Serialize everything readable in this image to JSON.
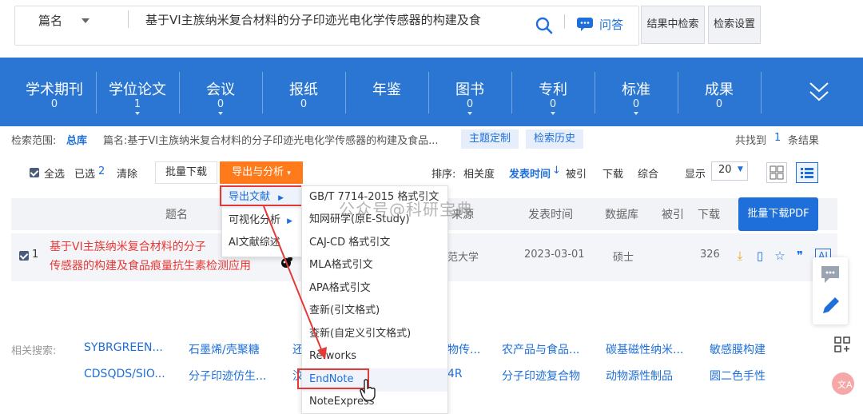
{
  "search": {
    "field": "篇名",
    "query": "基于VI主族纳米复合材料的分子印迹光电化学传感器的构建及食",
    "wenda": "问答",
    "in_results": "结果中检索",
    "settings": "检索设置"
  },
  "nav": [
    {
      "label": "学术期刊",
      "count": "0"
    },
    {
      "label": "学位论文",
      "count": "1"
    },
    {
      "label": "会议",
      "count": "0"
    },
    {
      "label": "报纸",
      "count": "0"
    },
    {
      "label": "年鉴",
      "count": ""
    },
    {
      "label": "图书",
      "count": "0"
    },
    {
      "label": "专利",
      "count": "0"
    },
    {
      "label": "标准",
      "count": "0"
    },
    {
      "label": "成果",
      "count": "0"
    }
  ],
  "scope": {
    "label": "检索范围:",
    "db": "总库",
    "condition": "篇名:基于VI主族纳米复合材料的分子印迹光电化学传感器的构建及食品...",
    "topic_btn": "主题定制",
    "history_btn": "检索历史",
    "found_prefix": "共找到",
    "found_count": "1",
    "found_suffix": "条结果"
  },
  "toolbar": {
    "select_all": "全选",
    "selected": "已选",
    "selected_count": "2",
    "clear": "清除",
    "batch_download": "批量下载",
    "export": "导出与分析",
    "sort_label": "排序:",
    "sort_relevance": "相关度",
    "sort_date": "发表时间",
    "sort_cited": "被引",
    "sort_download": "下载",
    "sort_overall": "综合",
    "display_label": "显示",
    "display_value": "20"
  },
  "table": {
    "headers": [
      "题名",
      "来源",
      "发表时间",
      "数据库",
      "被引",
      "下载"
    ],
    "pdf_button": "批量下载PDF",
    "row": {
      "index": "1",
      "title_line1": "基于VI主族纳米复合材料的分子",
      "title_line2": "传感器的构建及食品痕量抗生素检测应用",
      "source": "范大学",
      "date": "2023-03-01",
      "db": "硕士",
      "downloads": "326"
    }
  },
  "export_menu": [
    "导出文献",
    "可视化分析",
    "AI文献综述"
  ],
  "cite_menu": [
    "GB/T 7714-2015 格式引文",
    "知网研学(原E-Study)",
    "CAJ-CD 格式引文",
    "MLA格式引文",
    "APA格式引文",
    "查新(引文格式)",
    "查新(自定义引文格式)",
    "Refworks",
    "EndNote",
    "NoteExpress"
  ],
  "related": {
    "label": "相关搜索:",
    "row1": [
      "SYBRGREEN...",
      "石墨烯/壳聚糖",
      "还",
      "物传...",
      "农产品与食品...",
      "碳基磁性纳米...",
      "敏感膜构建"
    ],
    "row2": [
      "CDSQDS/SIO...",
      "分子印迹仿生...",
      "汶",
      "4R",
      "分子印迹复合物",
      "动物源性制品",
      "圆二色手性"
    ]
  },
  "watermark": "公众号@科研宝典",
  "colors": {
    "nav_blue": "#2a76d2",
    "accent_orange": "#ff7a1a",
    "link_blue": "#1e6fd9",
    "highlight_red": "#e53935"
  }
}
